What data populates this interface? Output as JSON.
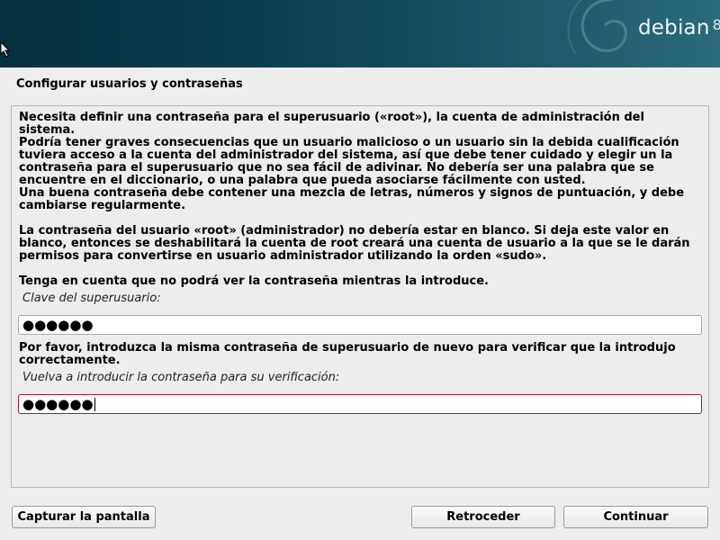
{
  "header": {
    "logo_text": "debian",
    "logo_version": "8"
  },
  "page": {
    "title": "Configurar usuarios y contraseñas"
  },
  "content": {
    "para1": "Necesita definir una contraseña para el superusuario («root»), la cuenta de administración del sistema.\nPodría tener graves consecuencias que un usuario malicioso o un usuario sin la debida cualificación\ntuviera acceso a la cuenta del administrador del sistema, así que debe tener cuidado y elegir un la\ncontraseña para el superusuario que no sea fácil de adivinar. No debería ser una palabra que se\nencuentre en el diccionario, o una palabra que pueda asociarse fácilmente con usted.",
    "para2": "Una buena contraseña debe contener una mezcla de letras, números y signos de puntuación, y debe\ncambiarse regularmente.",
    "para3": "La contraseña del usuario «root» (administrador) no debería estar en blanco. Si deja este valor en\nblanco, entonces se deshabilitará la cuenta de root creará una cuenta de usuario a la que se le darán\npermisos para convertirse en usuario administrador utilizando la orden «sudo».",
    "para4": "Tenga en cuenta que no podrá ver la contraseña mientras la introduce.",
    "root_password_label": "Clave del superusuario:",
    "root_password_value": "●●●●●●",
    "verify_para": "Por favor, introduzca la misma contraseña de superusuario de nuevo para verificar que la introdujo\ncorrectamente.",
    "verify_password_label": "Vuelva a introducir la contraseña para su verificación:",
    "verify_password_value": "●●●●●●"
  },
  "buttons": {
    "screenshot": "Capturar la pantalla",
    "back": "Retroceder",
    "continue": "Continuar"
  },
  "colors": {
    "banner": "#0a3c4f",
    "focus_border": "#b0123f",
    "background": "#ededed"
  }
}
